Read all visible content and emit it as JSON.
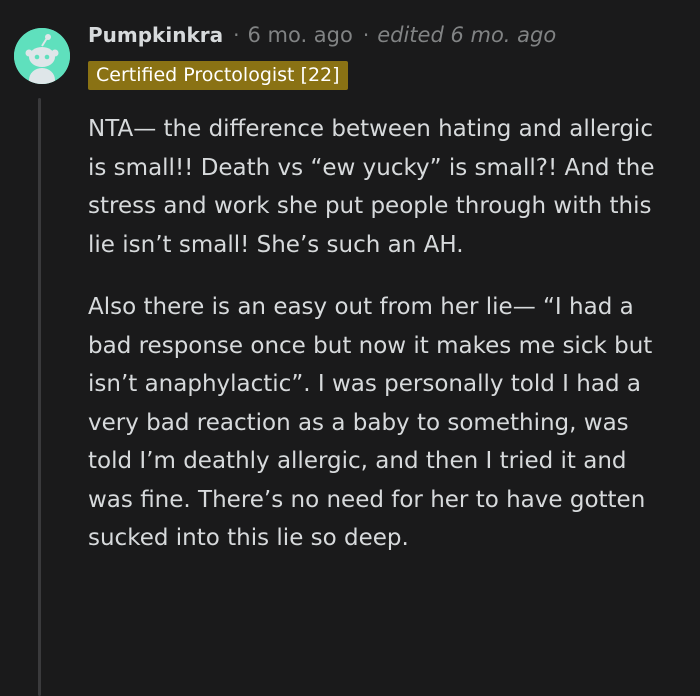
{
  "comment": {
    "username": "Pumpkinkra",
    "separator": "·",
    "time": "6 mo. ago",
    "edited": "edited 6 mo. ago",
    "flair": "Certified Proctologist [22]",
    "paragraphs": [
      "NTA— the difference between hating and allergic is small!! Death vs “ew yucky” is small?! And the stress and work she put people through with this lie isn’t small! She’s such an AH.",
      "Also there is an easy out from her lie— “I had a bad response once but now it makes me sick but isn’t anaphylactic”. I was personally told I had a very bad reaction as a baby to something, was told I’m deathly allergic, and then I tried it and was fine. There’s no need for her to have gotten sucked into this lie so deep."
    ]
  },
  "colors": {
    "background": "#1a1a1b",
    "text": "#d7dadc",
    "muted": "#818384",
    "flair_bg": "#8a7214",
    "avatar_bg": "#5fe0bd",
    "thread_line": "#3a3a3c"
  },
  "icons": {
    "avatar": "snoo-avatar-icon"
  }
}
